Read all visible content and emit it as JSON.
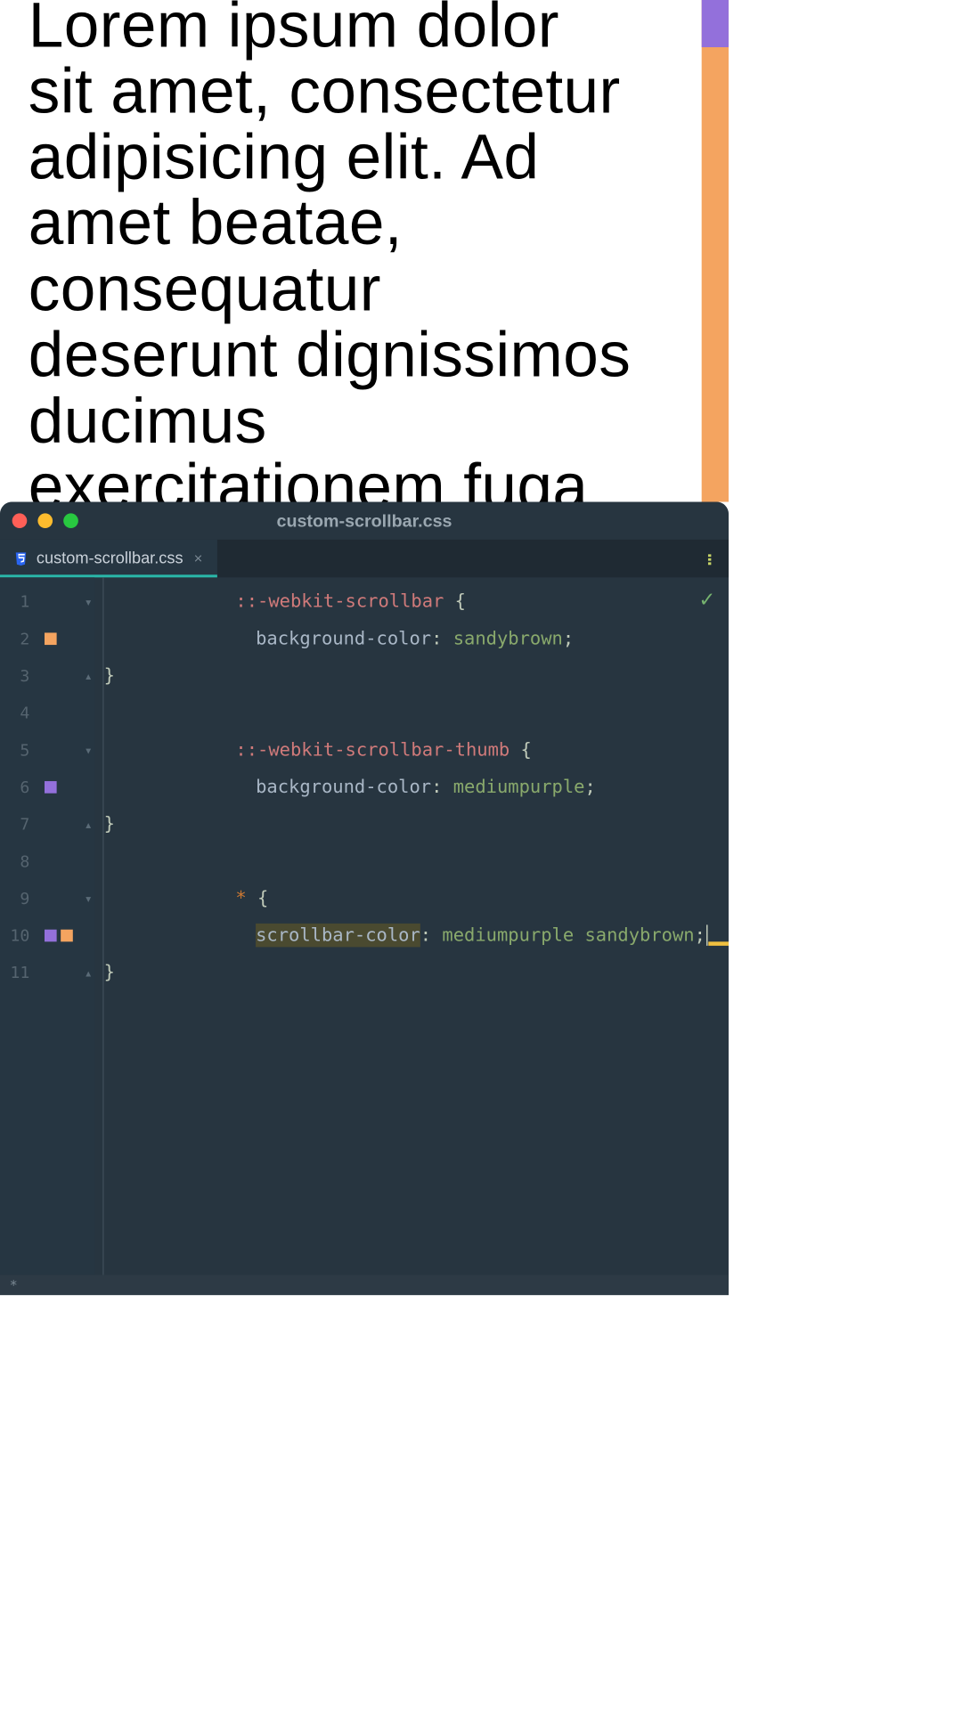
{
  "preview": {
    "body_text": "Lorem ipsum dolor sit amet, consectetur adipisicing elit. Ad amet beatae, consequatur deserunt dignissimos ducimus exercitationem fuga fugiat impedit in mollitia natus"
  },
  "window": {
    "title": "custom-scrollbar.css"
  },
  "tab": {
    "label": "custom-scrollbar.css",
    "close_glyph": "×"
  },
  "colors": {
    "sandybrown": "#f4a460",
    "mediumpurple": "#9370db"
  },
  "code": {
    "lines": [
      {
        "n": "1"
      },
      {
        "n": "2"
      },
      {
        "n": "3"
      },
      {
        "n": "4"
      },
      {
        "n": "5"
      },
      {
        "n": "6"
      },
      {
        "n": "7"
      },
      {
        "n": "8"
      },
      {
        "n": "9"
      },
      {
        "n": "10"
      },
      {
        "n": "11"
      }
    ],
    "t": {
      "sel1": "::-webkit-scrollbar",
      "brace_open": " {",
      "prop_bg": "background-color",
      "colon_sp": ": ",
      "val_sandy": "sandybrown",
      "semi": ";",
      "brace_close": "}",
      "sel2": "::-webkit-scrollbar-thumb",
      "val_purple": "mediumpurple",
      "star": "*",
      "prop_sc": "scrollbar-color",
      "val_pair": "mediumpurple sandybrown"
    }
  },
  "status": {
    "text": "*"
  },
  "fold_glyphs": {
    "open": "▾",
    "close": "▴"
  }
}
